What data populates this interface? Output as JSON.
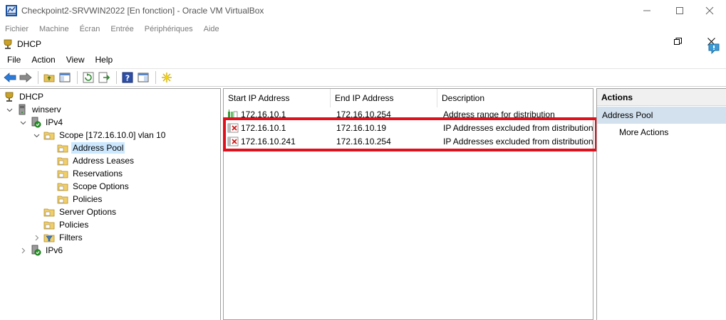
{
  "vbox": {
    "title": "Checkpoint2-SRVWIN2022 [En fonction] - Oracle VM VirtualBox",
    "menu": [
      "Fichier",
      "Machine",
      "Écran",
      "Entrée",
      "Périphériques",
      "Aide"
    ]
  },
  "dhcp_window": {
    "title": "DHCP",
    "menu": [
      "File",
      "Action",
      "View",
      "Help"
    ]
  },
  "tree": [
    {
      "label": "DHCP",
      "level": 0,
      "chevron": "",
      "icon": "dhcp-icon"
    },
    {
      "label": "winserv",
      "level": 1,
      "chevron": "expanded",
      "icon": "server-icon"
    },
    {
      "label": "IPv4",
      "level": 2,
      "chevron": "expanded",
      "icon": "ipv4-icon"
    },
    {
      "label": "Scope [172.16.10.0] vlan 10",
      "level": 3,
      "chevron": "expanded",
      "icon": "folder-icon"
    },
    {
      "label": "Address Pool",
      "level": 4,
      "chevron": "",
      "icon": "folder-icon",
      "selected": true
    },
    {
      "label": "Address Leases",
      "level": 4,
      "chevron": "",
      "icon": "folder-icon"
    },
    {
      "label": "Reservations",
      "level": 4,
      "chevron": "",
      "icon": "folder-icon"
    },
    {
      "label": "Scope Options",
      "level": 4,
      "chevron": "",
      "icon": "folder-icon"
    },
    {
      "label": "Policies",
      "level": 4,
      "chevron": "",
      "icon": "folder-icon"
    },
    {
      "label": "Server Options",
      "level": 3,
      "chevron": "",
      "icon": "folder-icon"
    },
    {
      "label": "Policies",
      "level": 3,
      "chevron": "",
      "icon": "folder-icon"
    },
    {
      "label": "Filters",
      "level": 3,
      "chevron": "collapsed",
      "icon": "filter-icon"
    },
    {
      "label": "IPv6",
      "level": 2,
      "chevron": "collapsed",
      "icon": "ipv6-icon"
    }
  ],
  "list": {
    "columns": [
      "Start IP Address",
      "End IP Address",
      "Description"
    ],
    "rows": [
      {
        "start": "172.16.10.1",
        "end": "172.16.10.254",
        "description": "Address range for distribution",
        "icon": "range-icon"
      },
      {
        "start": "172.16.10.1",
        "end": "172.16.10.19",
        "description": "IP Addresses excluded from distribution",
        "icon": "exclusion-icon"
      },
      {
        "start": "172.16.10.241",
        "end": "172.16.10.254",
        "description": "IP Addresses excluded from distribution",
        "icon": "exclusion-icon"
      }
    ]
  },
  "actions": {
    "header": "Actions",
    "section": "Address Pool",
    "item": "More Actions"
  },
  "colors": {
    "highlight": "#e0101c",
    "selection": "#cce8ff",
    "actions_section": "#d3e1ef"
  }
}
